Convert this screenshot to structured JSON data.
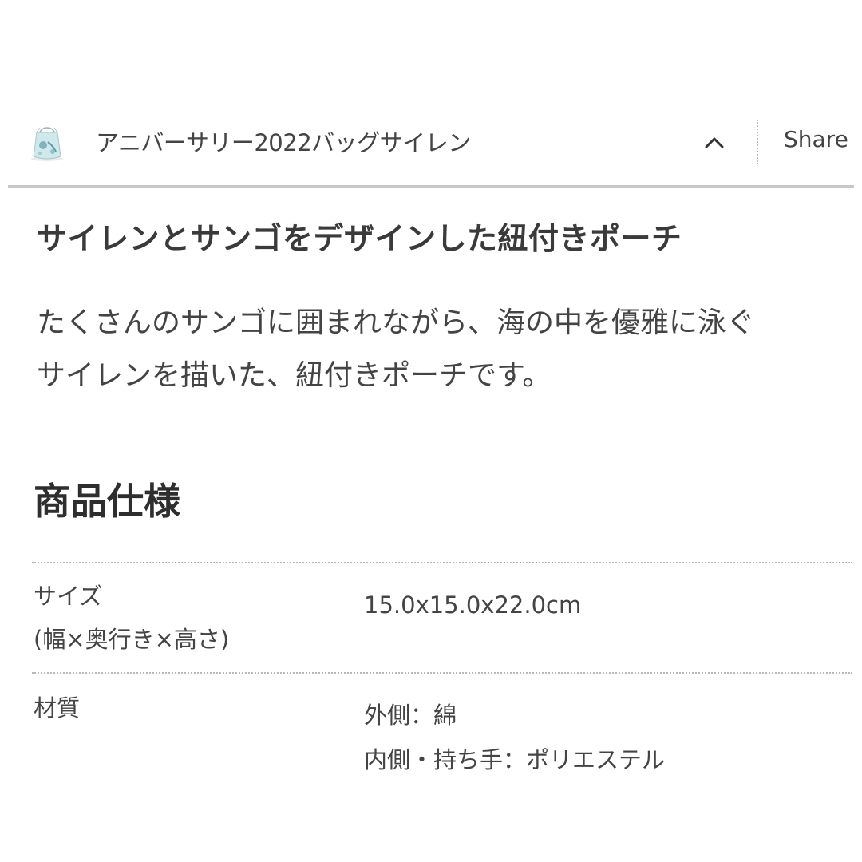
{
  "header": {
    "title": "アニバーサリー2022バッグサイレン",
    "thumbnail_icon": "pouch-thumbnail",
    "collapse_icon": "chevron-up-icon",
    "share_label": "Share"
  },
  "product": {
    "heading": "サイレンとサンゴをデザインした紐付きポーチ",
    "description_lines": [
      "たくさんのサンゴに囲まれながら、海の中を優雅に泳ぐ",
      "サイレンを描いた、紐付きポーチです。"
    ]
  },
  "specs": {
    "title": "商品仕様",
    "rows": [
      {
        "label_lines": [
          "サイズ",
          "(幅×奥行き×高さ)"
        ],
        "value_lines": [
          "15.0x15.0x22.0cm"
        ]
      },
      {
        "label_lines": [
          "材質"
        ],
        "value_lines": [
          "外側：綿",
          "内側・持ち手：ポリエステル"
        ]
      }
    ]
  },
  "colors": {
    "text": "#444444",
    "divider": "#c8c8c8",
    "pouch_tint": "#bfe0e4"
  }
}
